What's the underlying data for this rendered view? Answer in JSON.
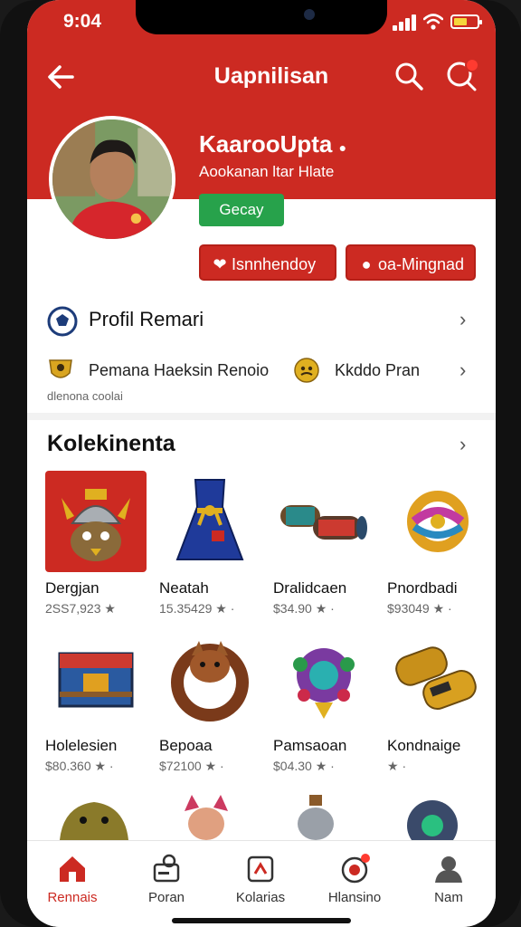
{
  "status": {
    "time": "9:04"
  },
  "header": {
    "title": "Uapnilisan"
  },
  "profile": {
    "name": "KaarooUpta",
    "subtitle": "Aookanan ltar Hlate",
    "badge": "Gecay",
    "btn_left": "Isnnhendoy",
    "btn_right": "oa-Mingnad"
  },
  "profile_section": {
    "title": "Profil Remari"
  },
  "awards": [
    {
      "label": "Pemana Haeksin Renoio",
      "icon": "gold-shield-icon"
    },
    {
      "label": "Kkddo Pran",
      "icon": "gold-medal-icon"
    }
  ],
  "awards_note": "dlenona coolai",
  "collection": {
    "title": "Kolekinenta",
    "items": [
      {
        "name": "Dergjan",
        "value": "2SS7,923 ★",
        "icon": "viking-helmet-icon"
      },
      {
        "name": "Neatah",
        "value": "15.35429 ★ ·",
        "icon": "blue-dress-icon"
      },
      {
        "name": "Dralidcaen",
        "value": "$34.90 ★ ·",
        "icon": "scroll-rolls-icon"
      },
      {
        "name": "Pnordbadi",
        "value": "$93049 ★ ·",
        "icon": "knot-ring-icon"
      },
      {
        "name": "Holelesien",
        "value": "$80.360 ★ ·",
        "icon": "treasure-chest-icon"
      },
      {
        "name": "Bepoaa",
        "value": "$72100 ★ ·",
        "icon": "fox-ring-icon"
      },
      {
        "name": "Pamsaoan",
        "value": "$04.30 ★ ·",
        "icon": "gem-amulet-icon"
      },
      {
        "name": "Kondnaige",
        "value": "★ ·",
        "icon": "golden-bracers-icon"
      }
    ]
  },
  "tabs": [
    {
      "label": "Rennais",
      "icon": "home-icon",
      "active": true
    },
    {
      "label": "Poran",
      "icon": "profile-card-icon"
    },
    {
      "label": "Kolarias",
      "icon": "collection-icon"
    },
    {
      "label": "Hlansino",
      "icon": "notification-icon"
    },
    {
      "label": "Nam",
      "icon": "user-icon"
    }
  ],
  "colors": {
    "brand": "#cc2a22",
    "success": "#27a24b"
  }
}
